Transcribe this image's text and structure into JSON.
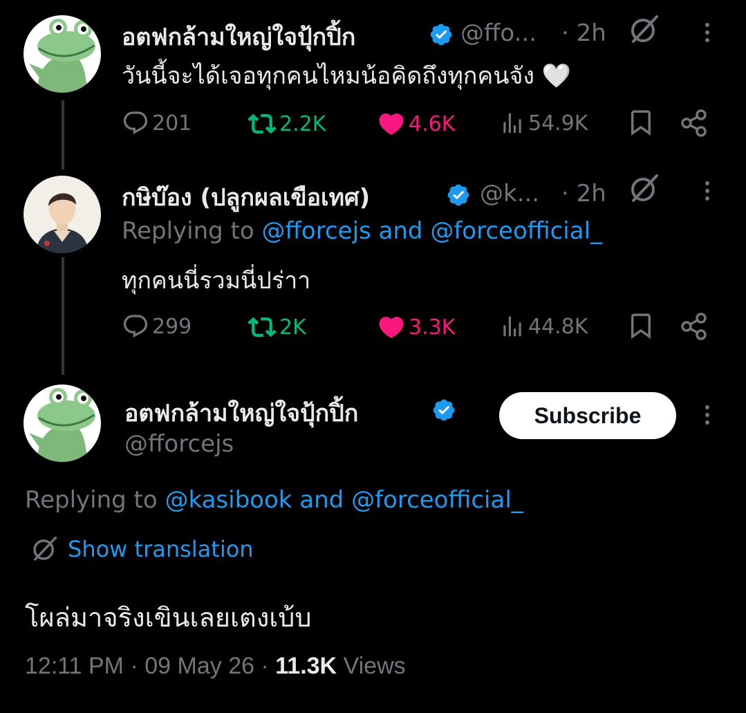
{
  "colors": {
    "background": "#000000",
    "text": "#e7e9ea",
    "muted": "#71767b",
    "link": "#1d9bf0",
    "retweet": "#00ba7c",
    "like": "#f91880",
    "verified": "#1d9bf0"
  },
  "tweet1": {
    "author_name": "อตฟกล้ามใหญ่ใจปุ้กปิ้ก",
    "handle": "@ffo...",
    "time": "· 2h",
    "text": "วันนี้จะได้เจอทุกคนไหมน้อคิดถึงทุกคนจัง 🤍",
    "actions": {
      "replies": "201",
      "retweets": "2.2K",
      "likes": "4.6K",
      "views": "54.9K"
    },
    "retweeted": true,
    "liked": true
  },
  "tweet2": {
    "author_name": "กษิบ๊อง (ปลูกผลเขือเทศ)",
    "handle": "@k...",
    "time": "· 2h",
    "replying_prefix": "Replying to",
    "replying_user1": "@fforcejs",
    "replying_and": "and",
    "replying_user2": "@forceofficial_",
    "text": "ทุกคนนี่รวมนี่ปร่าา",
    "actions": {
      "replies": "299",
      "retweets": "2K",
      "likes": "3.3K",
      "views": "44.8K"
    },
    "retweeted": true,
    "liked": true
  },
  "main": {
    "author_name": "อตฟกล้ามใหญ่ใจปุ้กปิ้ก",
    "handle": "@fforcejs",
    "subscribe_label": "Subscribe",
    "replying_prefix": "Replying to",
    "replying_user1": "@kasibook",
    "replying_and": "and",
    "replying_user2": "@forceofficial_",
    "show_translation": "Show translation",
    "text": "โผล่มาจริงเขินเลยเตงเบ้บ",
    "time": "12:11 PM",
    "date": "09 May 26",
    "views_count": "11.3K",
    "views_label": "Views"
  }
}
